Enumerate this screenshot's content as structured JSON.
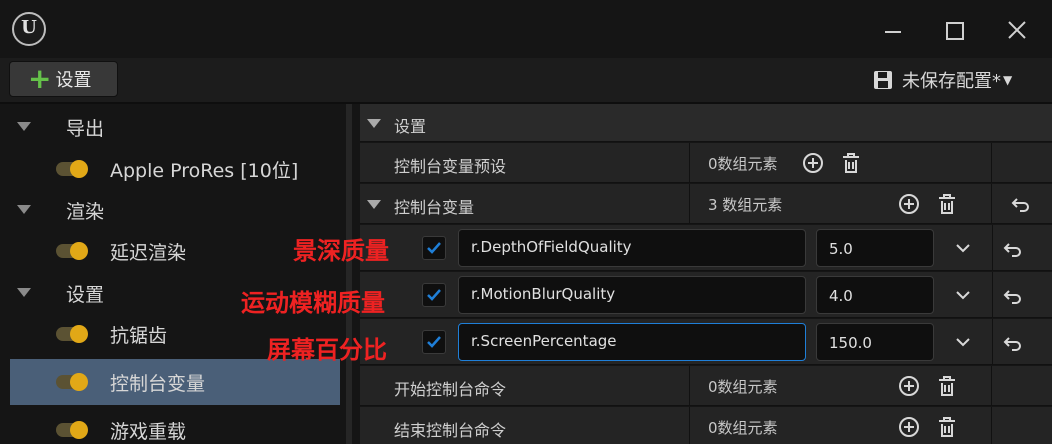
{
  "window": {
    "logo_text": "U"
  },
  "toolbar": {
    "add_label": "设置",
    "preset_label": "未保存配置*"
  },
  "left_panel": {
    "categories": [
      {
        "label": "导出",
        "items": [
          {
            "label": "Apple ProRes [10位]"
          }
        ]
      },
      {
        "label": "渲染",
        "items": [
          {
            "label": "延迟渲染"
          }
        ]
      },
      {
        "label": "设置",
        "items": [
          {
            "label": "抗锯齿"
          },
          {
            "label": "控制台变量"
          },
          {
            "label": "游戏重载"
          }
        ]
      }
    ],
    "selected_item": "控制台变量"
  },
  "right_panel": {
    "section_label": "设置",
    "cvar_presets": {
      "label": "控制台变量预设",
      "count": "0数组元素"
    },
    "cvars": {
      "label": "控制台变量",
      "count": "3 数组元素"
    },
    "cvar_entries": [
      {
        "name": "r.DepthOfFieldQuality",
        "value": "5.0",
        "enabled": true,
        "annotation": "景深质量"
      },
      {
        "name": "r.MotionBlurQuality",
        "value": "4.0",
        "enabled": true,
        "annotation": "运动模糊质量"
      },
      {
        "name": "r.ScreenPercentage",
        "value": "150.0",
        "enabled": true,
        "annotation": "屏幕百分比"
      }
    ],
    "start_commands": {
      "label": "开始控制台命令",
      "count": "0数组元素"
    },
    "end_commands": {
      "label": "结束控制台命令",
      "count": "0数组元素"
    }
  },
  "colors": {
    "accent_blue": "#1f7fd8",
    "toggle_yellow": "#e1a817",
    "add_green": "#65c14a",
    "annotation_red": "#ee2222",
    "selected_row": "#4a5f78"
  },
  "icons": [
    "unreal-logo-icon",
    "minimize-icon",
    "maximize-icon",
    "close-icon",
    "plus-icon",
    "save-icon",
    "add-element-icon",
    "trash-icon",
    "reset-icon",
    "chevron-down-icon",
    "checkmark-icon"
  ]
}
